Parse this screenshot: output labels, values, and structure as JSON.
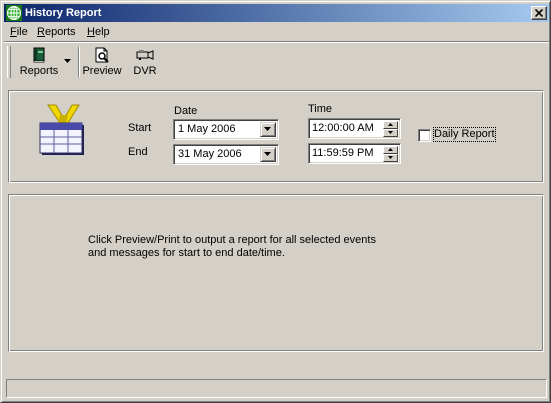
{
  "window": {
    "title": "History Report",
    "icon": "globe-grid-icon"
  },
  "menu": {
    "file": {
      "ul": "F",
      "rest": "ile"
    },
    "reports": {
      "ul": "R",
      "rest": "eports"
    },
    "help": {
      "ul": "H",
      "rest": "elp"
    }
  },
  "toolbar": {
    "reports_label": "Reports",
    "preview_label": "Preview",
    "dvr_label": "DVR"
  },
  "form": {
    "date_header": "Date",
    "time_header": "Time",
    "start_label": "Start",
    "end_label": "End",
    "start_date": "1  May 2006",
    "end_date": "31 May 2006",
    "start_time": "12:00:00 AM",
    "end_time": "11:59:59 PM",
    "daily_report_label": "Daily Report",
    "daily_report_checked": false
  },
  "message": {
    "line1": "Click Preview/Print to output a report for all selected events",
    "line2": "and messages for start to end date/time."
  },
  "status": {
    "text": ""
  }
}
